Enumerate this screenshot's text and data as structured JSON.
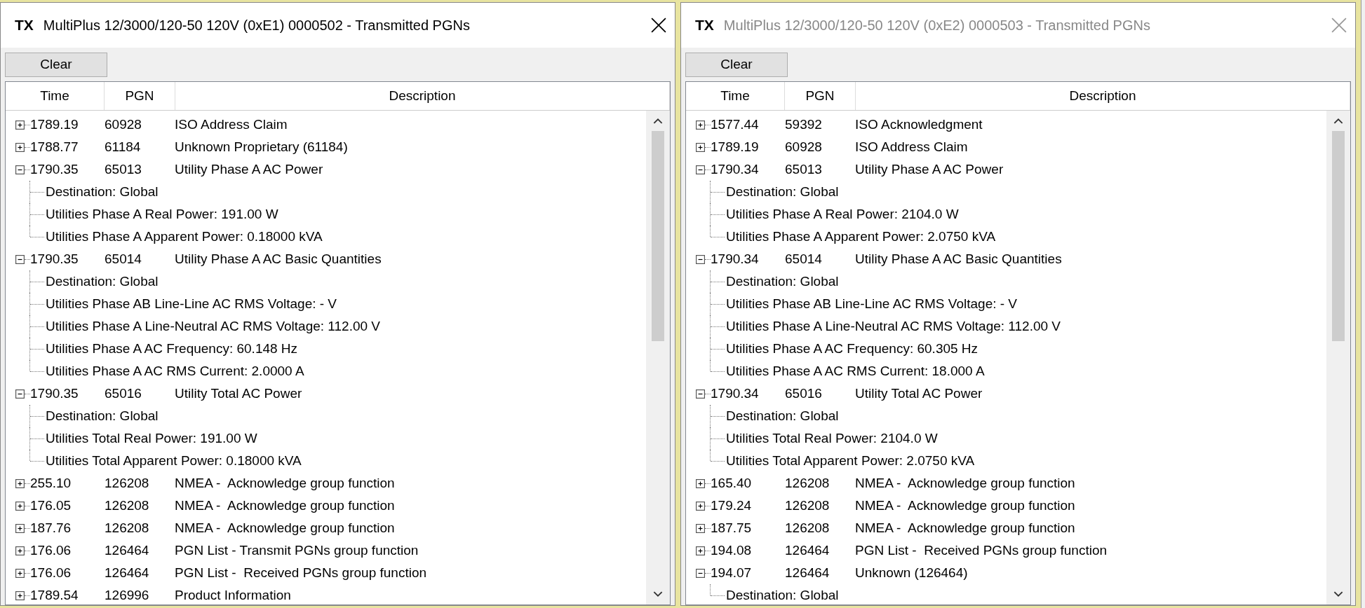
{
  "windows": [
    {
      "badge": "TX",
      "title": "MultiPlus 12/3000/120-50 120V (0xE1) 0000502 - Transmitted PGNs",
      "active": true,
      "clear_button": "Clear",
      "columns": [
        "Time",
        "PGN",
        "Description"
      ],
      "rows": [
        {
          "time": "1789.19",
          "pgn": "60928",
          "description": "ISO Address Claim",
          "expanded": false
        },
        {
          "time": "1788.77",
          "pgn": "61184",
          "description": "Unknown Proprietary (61184)",
          "expanded": false
        },
        {
          "time": "1790.35",
          "pgn": "65013",
          "description": "Utility Phase A AC Power",
          "expanded": true,
          "children": [
            "Destination: Global",
            "Utilities Phase A Real Power: 191.00 W",
            "Utilities Phase A Apparent Power: 0.18000 kVA"
          ]
        },
        {
          "time": "1790.35",
          "pgn": "65014",
          "description": "Utility Phase A AC Basic Quantities",
          "expanded": true,
          "children": [
            "Destination: Global",
            "Utilities Phase AB Line-Line AC RMS Voltage: - V",
            "Utilities Phase A Line-Neutral AC RMS Voltage: 112.00 V",
            "Utilities Phase A AC Frequency: 60.148 Hz",
            "Utilities Phase A AC RMS Current: 2.0000 A"
          ]
        },
        {
          "time": "1790.35",
          "pgn": "65016",
          "description": "Utility Total AC Power",
          "expanded": true,
          "children": [
            "Destination: Global",
            "Utilities Total Real Power: 191.00 W",
            "Utilities Total Apparent Power: 0.18000 kVA"
          ]
        },
        {
          "time": "255.10",
          "pgn": "126208",
          "description": "NMEA -  Acknowledge group function",
          "expanded": false
        },
        {
          "time": "176.05",
          "pgn": "126208",
          "description": "NMEA -  Acknowledge group function",
          "expanded": false
        },
        {
          "time": "187.76",
          "pgn": "126208",
          "description": "NMEA -  Acknowledge group function",
          "expanded": false
        },
        {
          "time": "176.06",
          "pgn": "126464",
          "description": "PGN List - Transmit PGNs group function",
          "expanded": false
        },
        {
          "time": "176.06",
          "pgn": "126464",
          "description": "PGN List -  Received PGNs group function",
          "expanded": false
        },
        {
          "time": "1789.54",
          "pgn": "126996",
          "description": "Product Information",
          "expanded": false
        }
      ]
    },
    {
      "badge": "TX",
      "title": "MultiPlus 12/3000/120-50 120V (0xE2) 0000503 - Transmitted PGNs",
      "active": false,
      "clear_button": "Clear",
      "columns": [
        "Time",
        "PGN",
        "Description"
      ],
      "rows": [
        {
          "time": "1577.44",
          "pgn": "59392",
          "description": "ISO Acknowledgment",
          "expanded": false
        },
        {
          "time": "1789.19",
          "pgn": "60928",
          "description": "ISO Address Claim",
          "expanded": false
        },
        {
          "time": "1790.34",
          "pgn": "65013",
          "description": "Utility Phase A AC Power",
          "expanded": true,
          "children": [
            "Destination: Global",
            "Utilities Phase A Real Power: 2104.0 W",
            "Utilities Phase A Apparent Power: 2.0750 kVA"
          ]
        },
        {
          "time": "1790.34",
          "pgn": "65014",
          "description": "Utility Phase A AC Basic Quantities",
          "expanded": true,
          "children": [
            "Destination: Global",
            "Utilities Phase AB Line-Line AC RMS Voltage: - V",
            "Utilities Phase A Line-Neutral AC RMS Voltage: 112.00 V",
            "Utilities Phase A AC Frequency: 60.305 Hz",
            "Utilities Phase A AC RMS Current: 18.000 A"
          ]
        },
        {
          "time": "1790.34",
          "pgn": "65016",
          "description": "Utility Total AC Power",
          "expanded": true,
          "children": [
            "Destination: Global",
            "Utilities Total Real Power: 2104.0 W",
            "Utilities Total Apparent Power: 2.0750 kVA"
          ]
        },
        {
          "time": "165.40",
          "pgn": "126208",
          "description": "NMEA -  Acknowledge group function",
          "expanded": false
        },
        {
          "time": "179.24",
          "pgn": "126208",
          "description": "NMEA -  Acknowledge group function",
          "expanded": false
        },
        {
          "time": "187.75",
          "pgn": "126208",
          "description": "NMEA -  Acknowledge group function",
          "expanded": false
        },
        {
          "time": "194.08",
          "pgn": "126464",
          "description": "PGN List -  Received PGNs group function",
          "expanded": false
        },
        {
          "time": "194.07",
          "pgn": "126464",
          "description": "Unknown (126464)",
          "expanded": true,
          "children": [
            "Destination: Global"
          ]
        }
      ]
    }
  ]
}
